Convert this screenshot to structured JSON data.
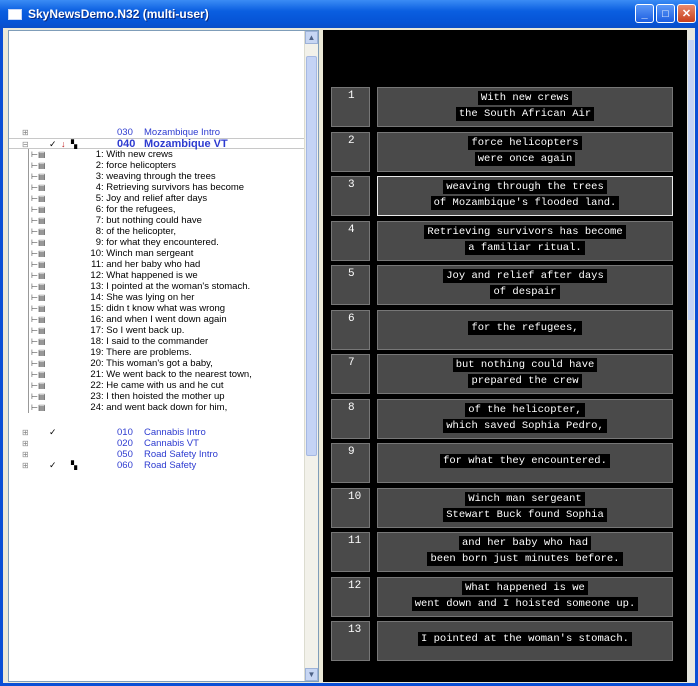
{
  "window": {
    "title": "SkyNewsDemo.N32 (multi-user)"
  },
  "tree": {
    "top_groups": [
      {
        "num": "030",
        "title": "Mozambique Intro",
        "check": "",
        "flag": "",
        "film": ""
      },
      {
        "num": "040",
        "title": "Mozambique VT",
        "check": "✓",
        "flag": "↓",
        "film": "▚"
      }
    ],
    "lines": [
      {
        "n": "1",
        "text": ": With new crews"
      },
      {
        "n": "2",
        "text": ": force helicopters"
      },
      {
        "n": "3",
        "text": ": weaving through the trees"
      },
      {
        "n": "4",
        "text": ": Retrieving survivors has become"
      },
      {
        "n": "5",
        "text": ": Joy and relief after days"
      },
      {
        "n": "6",
        "text": ": for the refugees,"
      },
      {
        "n": "7",
        "text": ": but nothing could have"
      },
      {
        "n": "8",
        "text": ": of the helicopter,"
      },
      {
        "n": "9",
        "text": ": for what they encountered."
      },
      {
        "n": "10",
        "text": ": Winch man sergeant"
      },
      {
        "n": "11",
        "text": ": and her baby who had"
      },
      {
        "n": "12",
        "text": ": What happened is we"
      },
      {
        "n": "13",
        "text": ": I pointed at the woman's stomach."
      },
      {
        "n": "14",
        "text": ": She was lying on her"
      },
      {
        "n": "15",
        "text": ": didn t know what was wrong"
      },
      {
        "n": "16",
        "text": ": and when I went down again"
      },
      {
        "n": "17",
        "text": ": So I went back up."
      },
      {
        "n": "18",
        "text": ": I said to the commander"
      },
      {
        "n": "19",
        "text": ": There are problems."
      },
      {
        "n": "20",
        "text": ": This woman's got a baby,"
      },
      {
        "n": "21",
        "text": ": We went back to the nearest town,"
      },
      {
        "n": "22",
        "text": ": He came with us and he cut"
      },
      {
        "n": "23",
        "text": ": I then hoisted the mother up"
      },
      {
        "n": "24",
        "text": ": and went back down for him,"
      }
    ],
    "bottom_groups": [
      {
        "num": "010",
        "title": "Cannabis Intro",
        "check": "✓",
        "film": ""
      },
      {
        "num": "020",
        "title": "Cannabis VT",
        "check": "",
        "film": ""
      },
      {
        "num": "050",
        "title": "Road Safety Intro",
        "check": "",
        "film": ""
      },
      {
        "num": "060",
        "title": "Road Safety",
        "check": "✓",
        "film": "▚"
      }
    ]
  },
  "captions": [
    {
      "num": "1",
      "lines": [
        "With new crews",
        "the South African Air"
      ]
    },
    {
      "num": "2",
      "lines": [
        "force helicopters",
        "were once again"
      ]
    },
    {
      "num": "3",
      "lines": [
        "weaving through the trees",
        "of Mozambique's flooded land."
      ]
    },
    {
      "num": "4",
      "lines": [
        "Retrieving survivors has become",
        "a familiar ritual."
      ]
    },
    {
      "num": "5",
      "lines": [
        "Joy and relief after days",
        "of despair"
      ]
    },
    {
      "num": "6",
      "lines": [
        "for the refugees,"
      ]
    },
    {
      "num": "7",
      "lines": [
        "but nothing could have",
        "prepared the crew"
      ]
    },
    {
      "num": "8",
      "lines": [
        "of the helicopter,",
        "which saved Sophia Pedro,"
      ]
    },
    {
      "num": "9",
      "lines": [
        "for what they encountered."
      ]
    },
    {
      "num": "10",
      "lines": [
        "Winch man sergeant",
        "Stewart Buck found Sophia"
      ]
    },
    {
      "num": "11",
      "lines": [
        "and her baby who had",
        "been born just minutes before."
      ]
    },
    {
      "num": "12",
      "lines": [
        "What happened is we",
        "went down and I hoisted someone up."
      ]
    },
    {
      "num": "13",
      "lines": [
        "I pointed at the woman's stomach."
      ]
    }
  ]
}
